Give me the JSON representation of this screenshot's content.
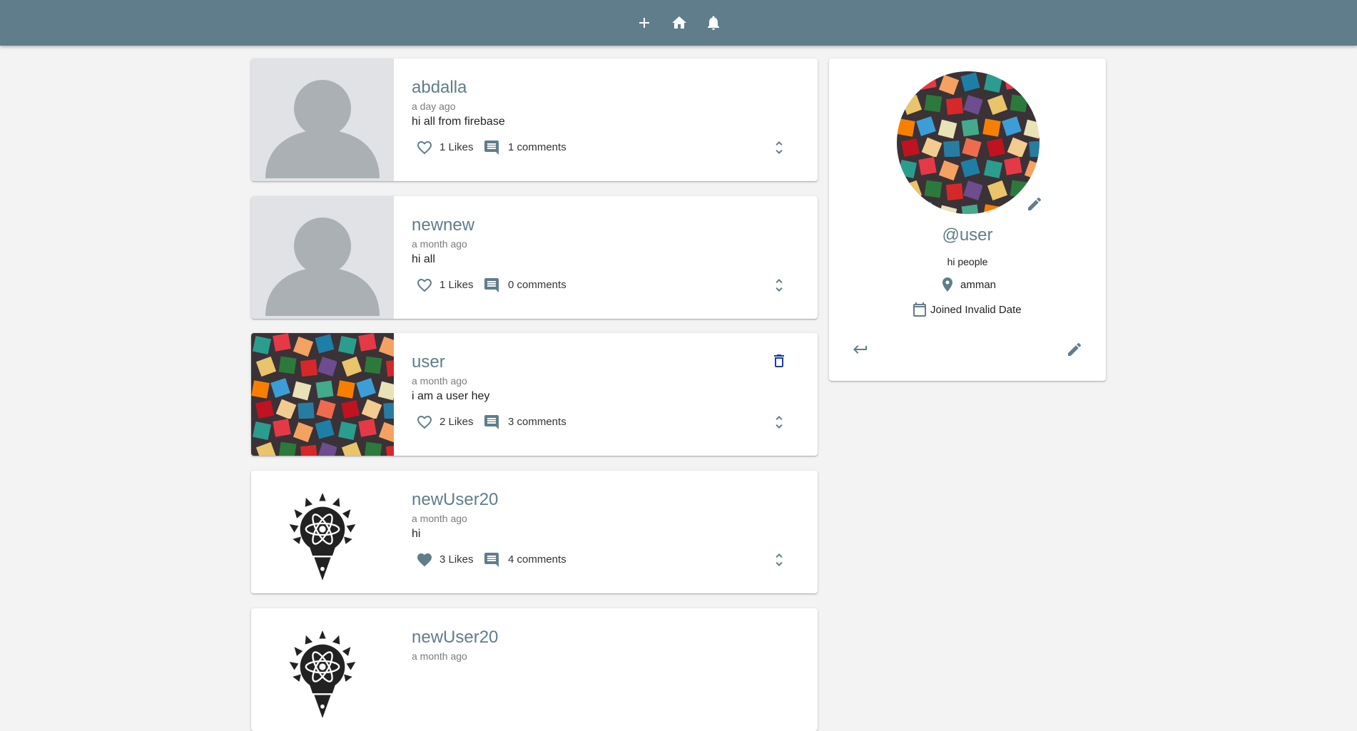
{
  "nav": {
    "items": [
      {
        "name": "add-post-button",
        "icon": "plus-icon"
      },
      {
        "name": "home-button",
        "icon": "home-icon"
      },
      {
        "name": "notifications-button",
        "icon": "bell-icon"
      }
    ]
  },
  "posts": [
    {
      "handle": "abdalla",
      "time": "a day ago",
      "body": "hi all from firebase",
      "likes": "1 Likes",
      "comments": "1 comments",
      "liked": false,
      "thumb": "placeholder",
      "deletable": false
    },
    {
      "handle": "newnew",
      "time": "a month ago",
      "body": "hi all",
      "likes": "1 Likes",
      "comments": "0 comments",
      "liked": false,
      "thumb": "placeholder",
      "deletable": false
    },
    {
      "handle": "user",
      "time": "a month ago",
      "body": "i am a user hey",
      "likes": "2 Likes",
      "comments": "3 comments",
      "liked": false,
      "thumb": "blocks",
      "deletable": true
    },
    {
      "handle": "newUser20",
      "time": "a month ago",
      "body": "hi",
      "likes": "3 Likes",
      "comments": "4 comments",
      "liked": true,
      "thumb": "emblem",
      "deletable": false
    },
    {
      "handle": "newUser20",
      "time": "a month ago",
      "body": "",
      "likes": "",
      "comments": "",
      "liked": false,
      "thumb": "emblem",
      "deletable": false
    }
  ],
  "profile": {
    "handle": "@user",
    "bio": "hi people",
    "location": "amman",
    "joined": "Joined Invalid Date"
  },
  "colors": {
    "topbar": "#607d8b",
    "accent": "#607d8b",
    "background": "#f3f3f3",
    "delete": "#1a3e9c"
  }
}
